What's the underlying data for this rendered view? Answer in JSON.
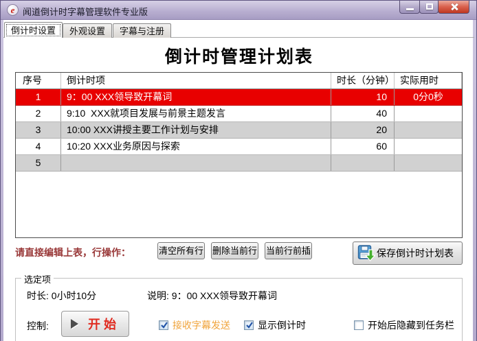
{
  "window": {
    "title": "闻道倒计时字幕管理软件专业版",
    "logo_char": "e"
  },
  "tabs": [
    {
      "label": "倒计时设置",
      "active": true
    },
    {
      "label": "外观设置",
      "active": false
    },
    {
      "label": "字幕与注册",
      "active": false
    }
  ],
  "main": {
    "title": "倒计时管理计划表"
  },
  "table": {
    "headers": [
      "序号",
      "倒计时项",
      "时长（分钟）",
      "实际用时"
    ],
    "rows": [
      {
        "no": "1",
        "item": "9：00 XXX领导致开幕词",
        "duration": "10",
        "actual": "0分0秒",
        "selected": true
      },
      {
        "no": "2",
        "item": "9:10  XXX就项目发展与前景主题发言",
        "duration": "40",
        "actual": ""
      },
      {
        "no": "3",
        "item": "10:00 XXX讲授主要工作计划与安排",
        "duration": "20",
        "actual": ""
      },
      {
        "no": "4",
        "item": "10:20 XXX业务原因与探索",
        "duration": "60",
        "actual": ""
      },
      {
        "no": "5",
        "item": "",
        "duration": "",
        "actual": ""
      }
    ]
  },
  "row_ops": {
    "label": "请直接编辑上表，行操作：",
    "buttons": [
      "清空所有行",
      "删除当前行",
      "当前行前插"
    ],
    "save_label": "保存倒计时计划表"
  },
  "selection": {
    "group_label": "选定项",
    "duration_text": "时长: 0小时10分",
    "desc_text": "说明: 9：00 XXX领导致开幕词",
    "control_label": "控制:",
    "start_label": "开始",
    "checkboxes": [
      {
        "label": "接收字幕发送",
        "checked": true
      },
      {
        "label": "显示倒计时",
        "checked": true
      },
      {
        "label": "开始后隐藏到任务栏",
        "checked": false
      }
    ]
  },
  "colors": {
    "selected_row": "#e80000",
    "titlebar": "#b7adcf",
    "checkbox_orange": "#f0a43c",
    "start_red": "#e02b20",
    "ops_label_maroon": "#993838"
  }
}
